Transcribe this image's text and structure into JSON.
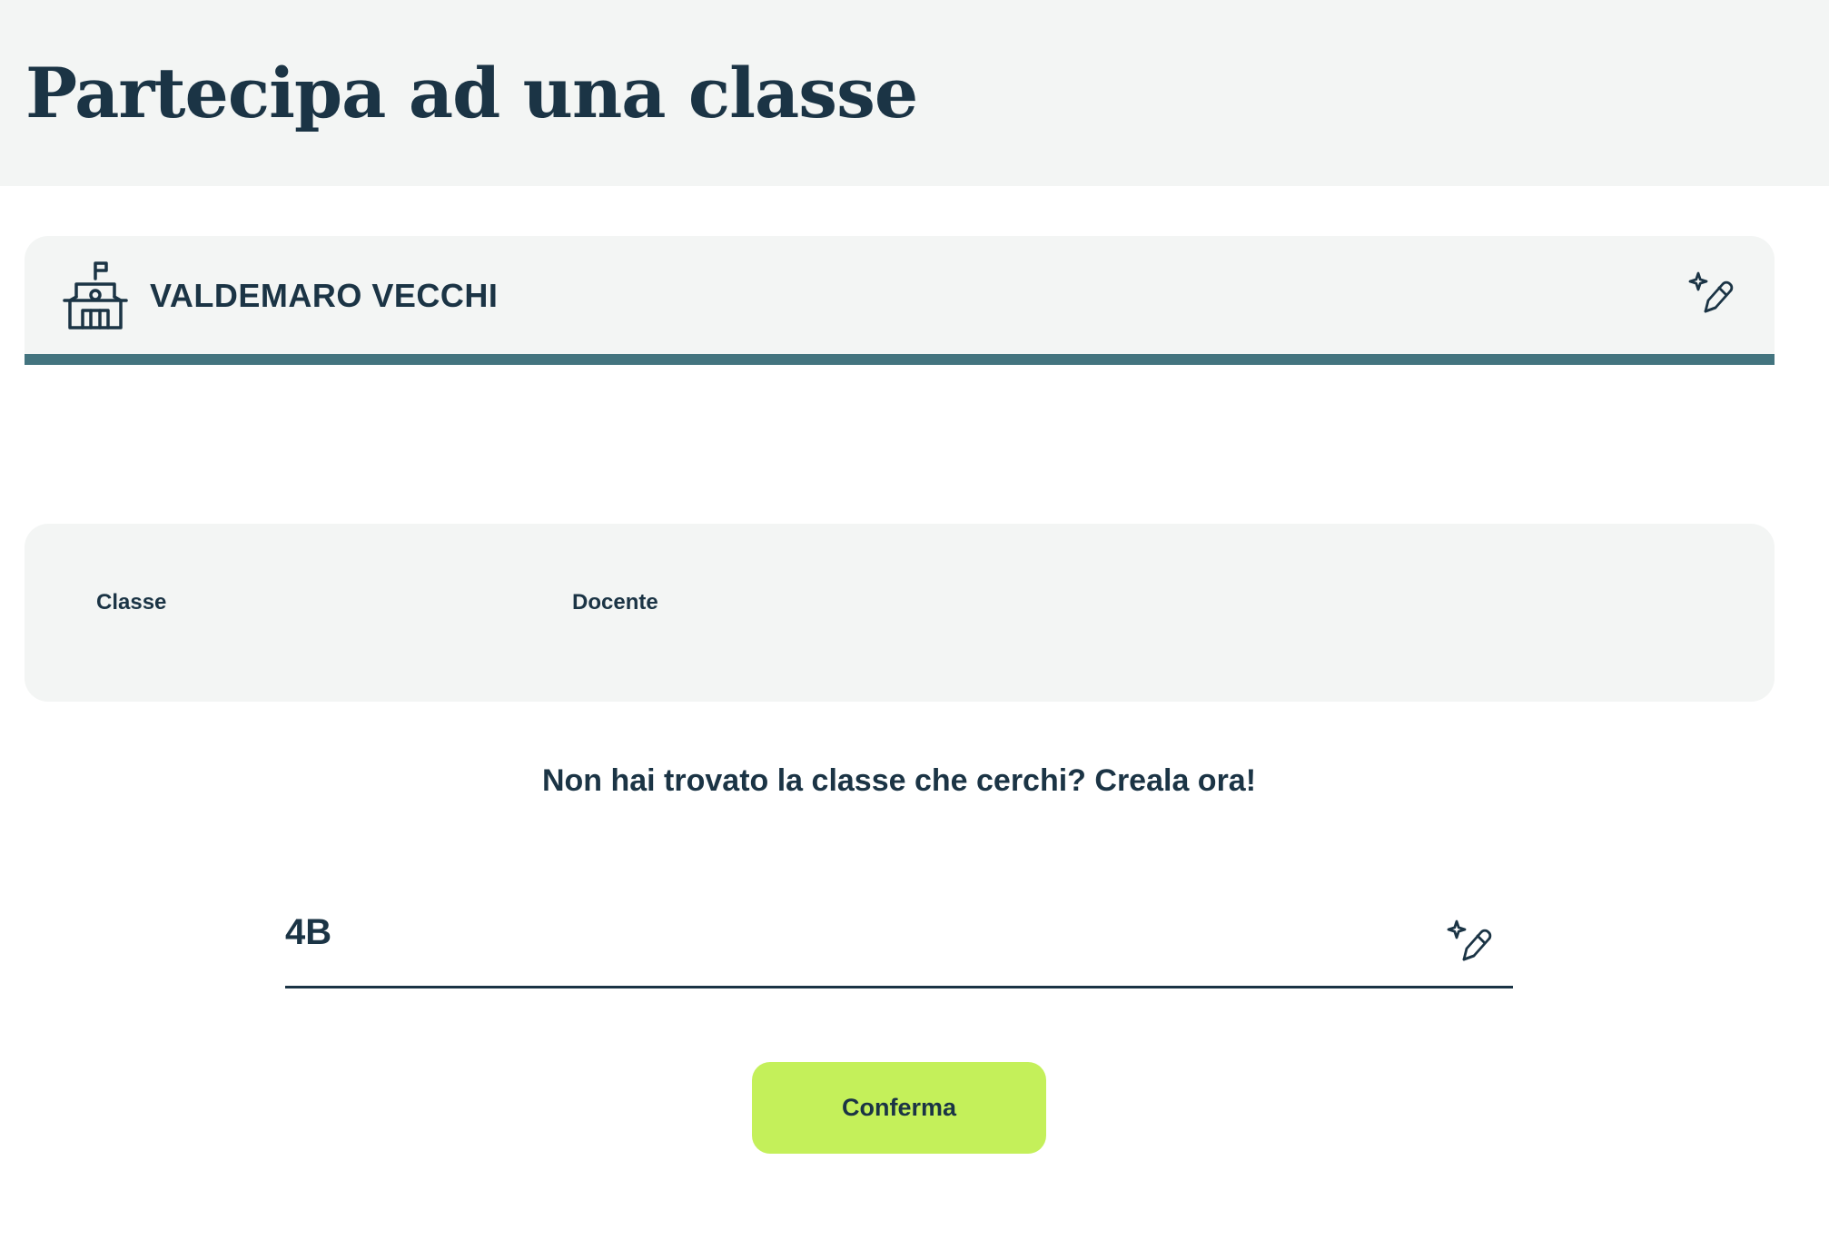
{
  "page": {
    "title": "Partecipa ad una classe"
  },
  "school": {
    "name": "VALDEMARO VECCHI",
    "icon": "school-icon",
    "edit_icon": "magic-pencil-icon"
  },
  "class_table": {
    "columns": [
      "Classe",
      "Docente"
    ]
  },
  "create_prompt": "Non hai trovato la classe che cerchi? Creala ora!",
  "class_input": {
    "value": "4B",
    "edit_icon": "magic-pencil-icon"
  },
  "confirm_button": {
    "label": "Conferma"
  },
  "colors": {
    "text": "#1b3445",
    "panel_background": "#f3f5f4",
    "accent_bar": "#43747f",
    "button_background": "#c4f05a"
  }
}
